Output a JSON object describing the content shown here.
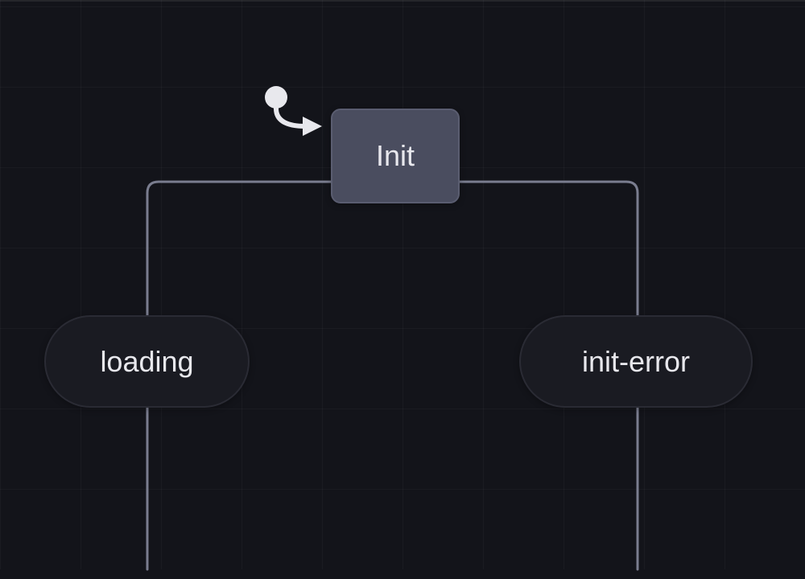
{
  "diagram": {
    "type": "state-machine",
    "initial_state": "Init",
    "states": {
      "init": {
        "label": "Init"
      }
    },
    "transitions": {
      "loading": {
        "label": "loading"
      },
      "init_error": {
        "label": "init-error"
      }
    },
    "edges": [
      {
        "from": "Init",
        "to": "loading"
      },
      {
        "from": "Init",
        "to": "init-error"
      }
    ]
  }
}
